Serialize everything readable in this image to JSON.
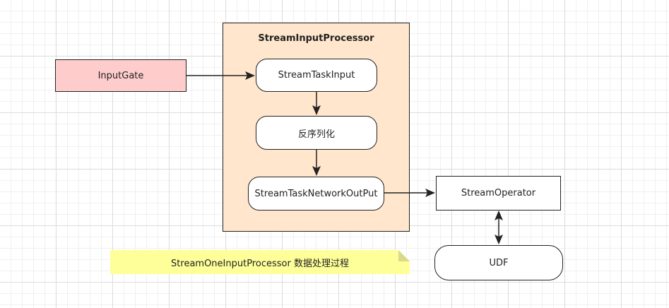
{
  "container": {
    "title": "StreamInputProcessor"
  },
  "nodes": {
    "input_gate": "InputGate",
    "stream_task_input": "StreamTaskInput",
    "deserialize": "反序列化",
    "stream_task_network_output": "StreamTaskNetworkOutPut",
    "stream_operator": "StreamOperator",
    "udf": "UDF"
  },
  "note": {
    "text": "StreamOneInputProcessor 数据处理过程"
  },
  "colors": {
    "container_fill": "#ffe6cc",
    "input_gate_fill": "#ffcccc",
    "note_fill": "#ffff99",
    "stroke": "#222222"
  }
}
